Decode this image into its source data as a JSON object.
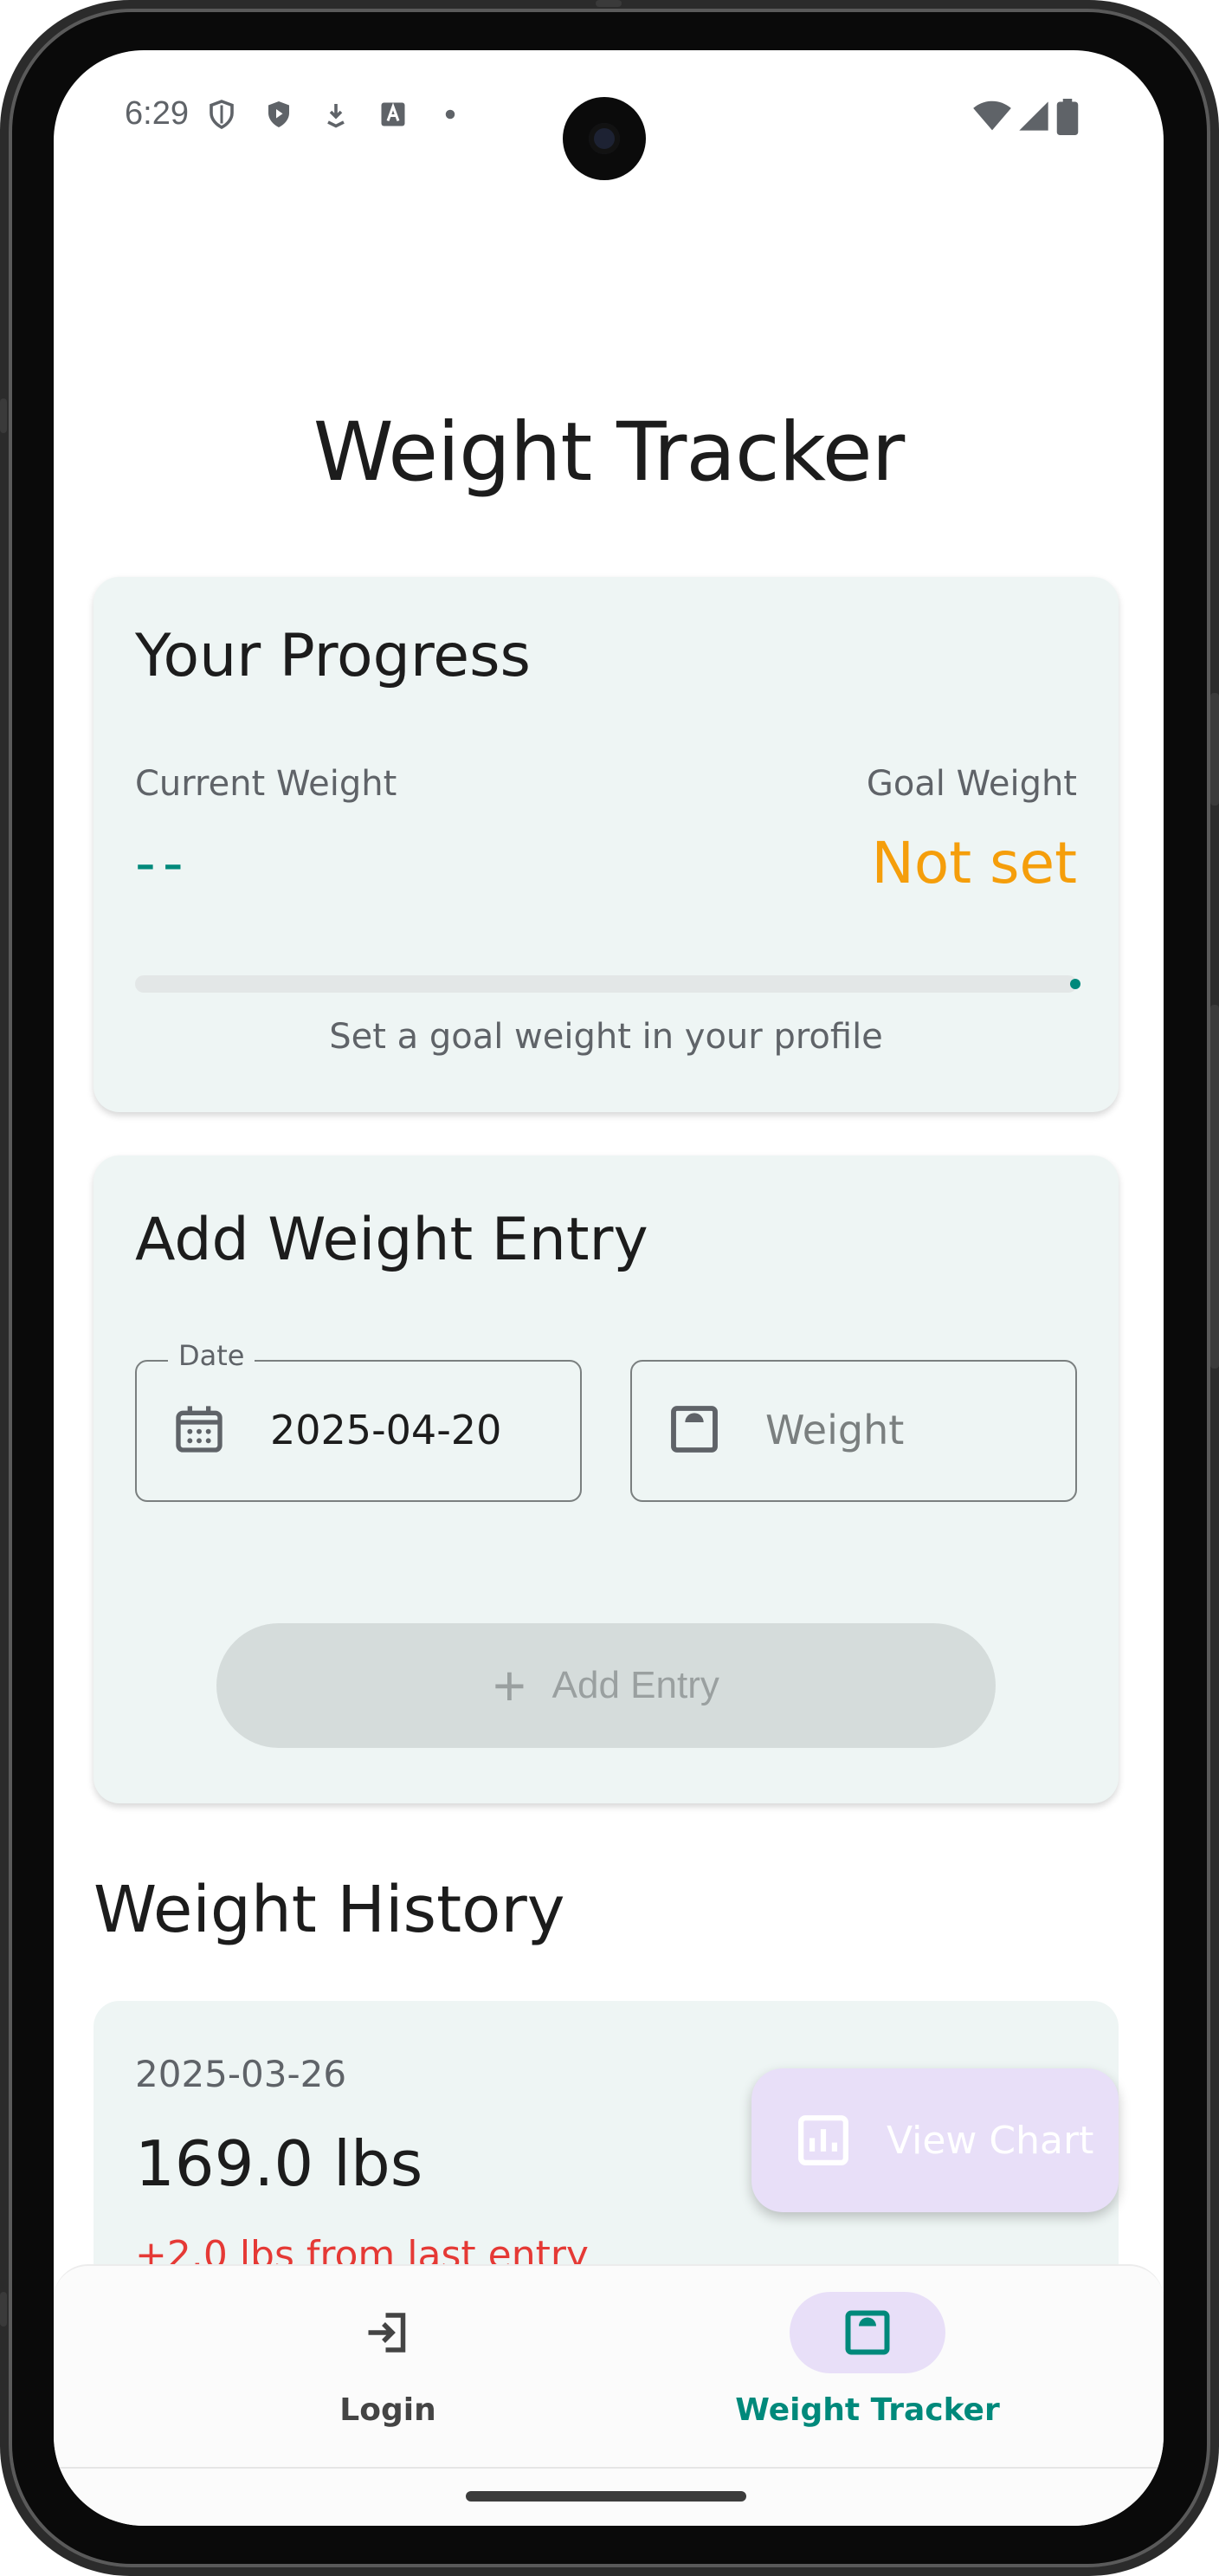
{
  "status_bar": {
    "time": "6:29"
  },
  "title": "Weight Tracker",
  "progress": {
    "heading": "Your Progress",
    "current_label": "Current Weight",
    "current_value": "--",
    "goal_label": "Goal Weight",
    "goal_value": "Not set",
    "progress_fraction": 0.0,
    "hint": "Set a goal weight in your profile"
  },
  "entry": {
    "heading": "Add Weight Entry",
    "date_label": "Date",
    "date_value": "2025-04-20",
    "weight_placeholder": "Weight",
    "add_button_label": "Add Entry"
  },
  "history": {
    "heading": "Weight History",
    "items": [
      {
        "date": "2025-03-26",
        "weight": "169.0 lbs",
        "change": "+2.0 lbs from last entry"
      }
    ]
  },
  "fab": {
    "label": "View Chart"
  },
  "nav": {
    "items": [
      {
        "label": "Login",
        "icon": "login-icon",
        "active": false
      },
      {
        "label": "Weight Tracker",
        "icon": "scale-icon",
        "active": true
      }
    ]
  },
  "colors": {
    "accent": "#00897b",
    "goal": "#f59e0b",
    "negative": "#e53935",
    "card_bg": "#eef5f4",
    "nav_active_bg": "#e8dff8"
  }
}
